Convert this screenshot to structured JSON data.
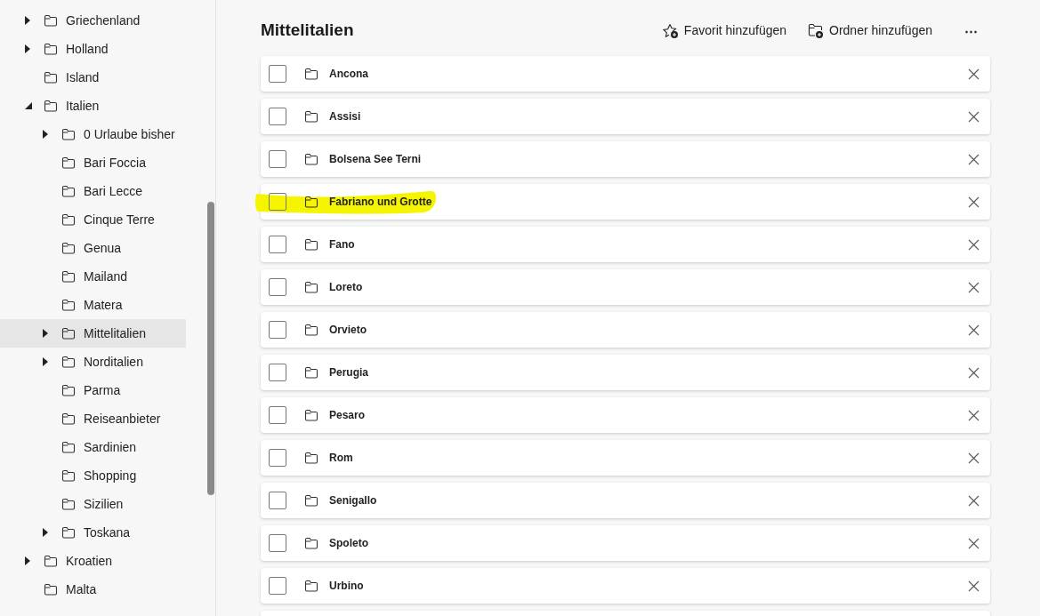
{
  "sidebar": {
    "items": [
      {
        "label": "Griechenland",
        "kind": "group",
        "expanded": false,
        "selected": false
      },
      {
        "label": "Holland",
        "kind": "group",
        "expanded": false,
        "selected": false
      },
      {
        "label": "Island",
        "kind": "leaf",
        "selected": false
      },
      {
        "label": "Italien",
        "kind": "group",
        "expanded": true,
        "selected": false,
        "children": [
          {
            "label": "0 Urlaube bisher",
            "kind": "group",
            "expanded": false,
            "selected": false
          },
          {
            "label": "Bari Foccia",
            "kind": "leaf",
            "selected": false
          },
          {
            "label": "Bari Lecce",
            "kind": "leaf",
            "selected": false
          },
          {
            "label": "Cinque Terre",
            "kind": "leaf",
            "selected": false
          },
          {
            "label": "Genua",
            "kind": "leaf",
            "selected": false
          },
          {
            "label": "Mailand",
            "kind": "leaf",
            "selected": false
          },
          {
            "label": "Matera",
            "kind": "leaf",
            "selected": false
          },
          {
            "label": "Mittelitalien",
            "kind": "group",
            "expanded": false,
            "selected": true
          },
          {
            "label": "Norditalien",
            "kind": "group",
            "expanded": false,
            "selected": false
          },
          {
            "label": "Parma",
            "kind": "leaf",
            "selected": false
          },
          {
            "label": "Reiseanbieter",
            "kind": "leaf",
            "selected": false
          },
          {
            "label": "Sardinien",
            "kind": "leaf",
            "selected": false
          },
          {
            "label": "Shopping",
            "kind": "leaf",
            "selected": false
          },
          {
            "label": "Sizilien",
            "kind": "leaf",
            "selected": false
          },
          {
            "label": "Toskana",
            "kind": "group",
            "expanded": false,
            "selected": false
          }
        ]
      },
      {
        "label": "Kroatien",
        "kind": "group",
        "expanded": false,
        "selected": false
      },
      {
        "label": "Malta",
        "kind": "leaf",
        "selected": false
      }
    ]
  },
  "main": {
    "title": "Mittelitalien",
    "actions": [
      {
        "kind": "favorite",
        "label": "Favorit hinzufügen"
      },
      {
        "kind": "folder",
        "label": "Ordner hinzufügen"
      },
      {
        "kind": "more",
        "label": "⋯"
      }
    ],
    "items": [
      {
        "label": "Ancona",
        "checked": false,
        "highlighted": false
      },
      {
        "label": "Assisi",
        "checked": false,
        "highlighted": false
      },
      {
        "label": "Bolsena See Terni",
        "checked": false,
        "highlighted": false
      },
      {
        "label": "Fabriano und Grotte",
        "checked": false,
        "highlighted": true
      },
      {
        "label": "Fano",
        "checked": false,
        "highlighted": false
      },
      {
        "label": "Loreto",
        "checked": false,
        "highlighted": false
      },
      {
        "label": "Orvieto",
        "checked": false,
        "highlighted": false
      },
      {
        "label": "Perugia",
        "checked": false,
        "highlighted": false
      },
      {
        "label": "Pesaro",
        "checked": false,
        "highlighted": false
      },
      {
        "label": "Rom",
        "checked": false,
        "highlighted": false
      },
      {
        "label": "Senigallo",
        "checked": false,
        "highlighted": false
      },
      {
        "label": "Spoleto",
        "checked": false,
        "highlighted": false
      },
      {
        "label": "Urbino",
        "checked": false,
        "highlighted": false
      }
    ]
  }
}
